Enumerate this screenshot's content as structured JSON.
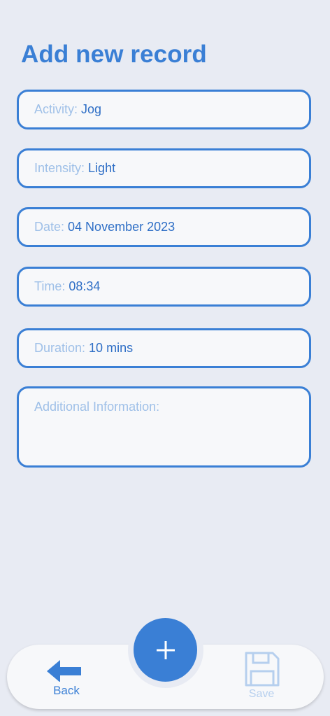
{
  "page": {
    "title": "Add new record"
  },
  "form": {
    "activity": {
      "label": "Activity:",
      "value": "Jog"
    },
    "intensity": {
      "label": "Intensity:",
      "value": "Light"
    },
    "date": {
      "label": "Date:",
      "value": "04 November 2023"
    },
    "time": {
      "label": "Time:",
      "value": "08:34"
    },
    "duration": {
      "label": "Duration:",
      "value": "10 mins"
    },
    "additional": {
      "placeholder": "Additional Information:"
    }
  },
  "nav": {
    "back_label": "Back",
    "add_icon": "plus-icon",
    "save_label": "Save"
  },
  "colors": {
    "accent": "#3a7fd5",
    "label_muted": "#9fc0e8",
    "disabled": "#b6cfee",
    "background": "#e8ebf3",
    "card": "#f7f8fa"
  }
}
